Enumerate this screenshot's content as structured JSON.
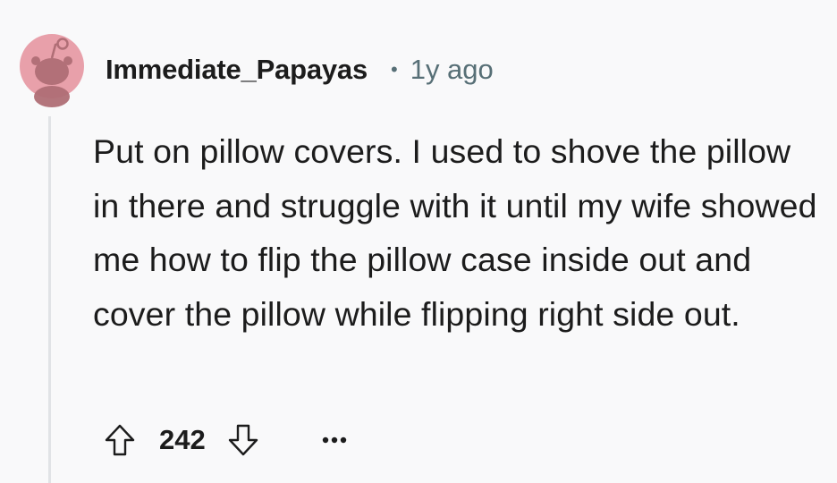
{
  "comment": {
    "username": "Immediate_Papayas",
    "separator": "•",
    "time": "1y ago",
    "body": "Put on pillow covers. I used to shove the pillow in there and struggle with it until my wife showed me how to flip the pillow case inside out and cover the pillow while flipping right side out.",
    "score": "242",
    "avatar_color": "#e8a0aa",
    "icons": {
      "avatar": "snoo-avatar-icon",
      "upvote": "arrow-up-icon",
      "downvote": "arrow-down-icon",
      "more": "more-horizontal-icon"
    }
  }
}
